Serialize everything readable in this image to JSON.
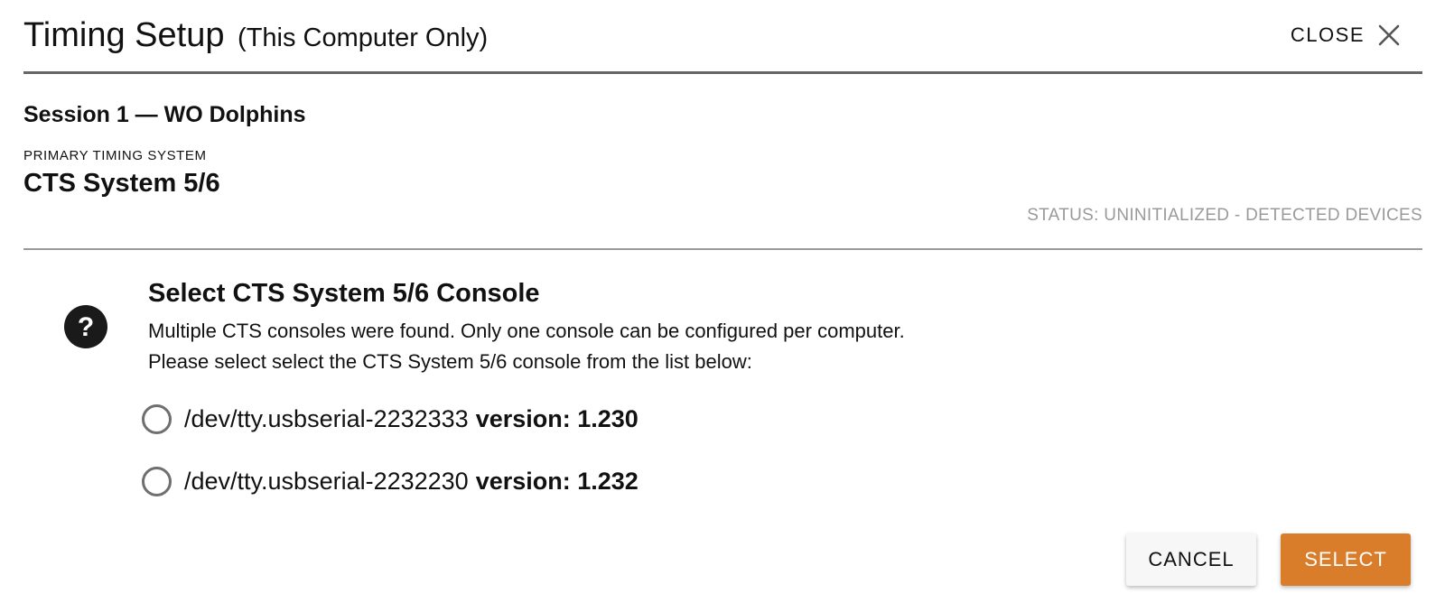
{
  "header": {
    "title": "Timing Setup",
    "subtitle": "(This Computer Only)",
    "close_label": "CLOSE",
    "close_icon": "close-icon"
  },
  "session": {
    "title": "Session 1 — WO Dolphins",
    "system_caption": "PRIMARY TIMING SYSTEM",
    "system_name": "CTS System 5/6",
    "status": "STATUS: UNINITIALIZED - DETECTED DEVICES"
  },
  "prompt": {
    "icon": "help-icon",
    "title": "Select CTS System 5/6 Console",
    "line1": "Multiple CTS consoles were found. Only one console can be configured per computer.",
    "line2": "Please select select the CTS System 5/6 console from the list below:"
  },
  "options": [
    {
      "device": "/dev/tty.usbserial-2232333",
      "version": "version: 1.230",
      "selected": false
    },
    {
      "device": "/dev/tty.usbserial-2232230",
      "version": "version: 1.232",
      "selected": false
    }
  ],
  "actions": {
    "cancel_label": "CANCEL",
    "select_label": "SELECT"
  },
  "colors": {
    "accent": "#d97d2b",
    "status_text": "#9a9a9a",
    "divider": "#666666"
  }
}
